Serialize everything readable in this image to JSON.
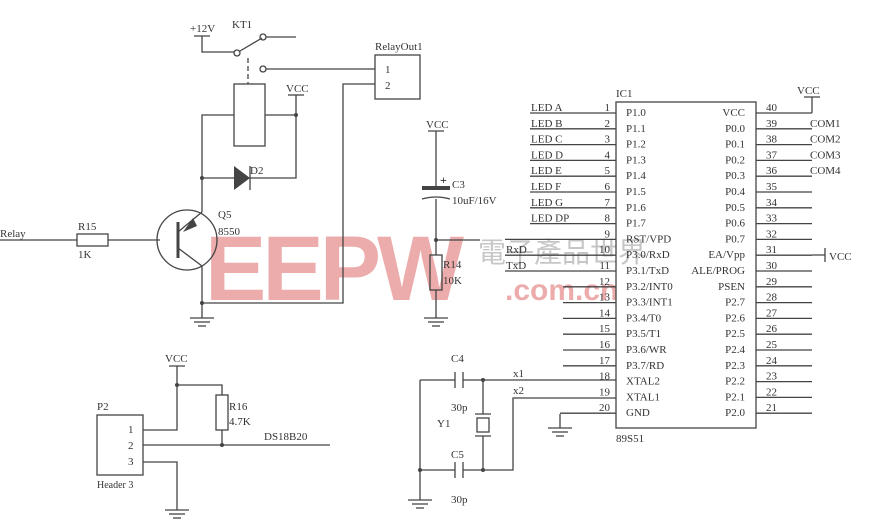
{
  "relay_circuit": {
    "input_net": "Relay",
    "r15": {
      "ref": "R15",
      "value": "1K"
    },
    "q5": {
      "ref": "Q5",
      "value": "8550"
    },
    "d2": {
      "ref": "D2"
    },
    "kt1": {
      "ref": "KT1",
      "supply": "+12V"
    },
    "coil_supply": "VCC",
    "relay_out": {
      "ref": "RelayOut1",
      "pins": [
        "1",
        "2"
      ]
    }
  },
  "reset_circuit": {
    "supply": "VCC",
    "c3": {
      "ref": "C3",
      "value": "10uF/16V"
    },
    "r14": {
      "ref": "R14",
      "value": "10K"
    }
  },
  "crystal": {
    "c4": {
      "ref": "C4",
      "value": "30p"
    },
    "c5": {
      "ref": "C5",
      "value": "30p"
    },
    "y1": {
      "ref": "Y1"
    },
    "net_x1": "x1",
    "net_x2": "x2"
  },
  "sensor": {
    "supply": "VCC",
    "p2": {
      "ref": "P2",
      "part": "Header 3",
      "pins": [
        "1",
        "2",
        "3"
      ]
    },
    "r16": {
      "ref": "R16",
      "value": "4.7K"
    },
    "net": "DS18B20"
  },
  "ic1": {
    "ref": "IC1",
    "part": "89S51",
    "vcc_label": "VCC",
    "ea_vcc_label": "VCC",
    "left_pins": [
      {
        "num": "1",
        "name": "P1.0",
        "net": "LED A"
      },
      {
        "num": "2",
        "name": "P1.1",
        "net": "LED B"
      },
      {
        "num": "3",
        "name": "P1.2",
        "net": "LED C"
      },
      {
        "num": "4",
        "name": "P1.3",
        "net": "LED D"
      },
      {
        "num": "5",
        "name": "P1.4",
        "net": "LED E"
      },
      {
        "num": "6",
        "name": "P1.5",
        "net": "LED F"
      },
      {
        "num": "7",
        "name": "P1.6",
        "net": "LED G"
      },
      {
        "num": "8",
        "name": "P1.7",
        "net": "LED DP"
      },
      {
        "num": "9",
        "name": "RST/VPD",
        "net": ""
      },
      {
        "num": "10",
        "name": "P3.0/RxD",
        "net": "RxD"
      },
      {
        "num": "11",
        "name": "P3.1/TxD",
        "net": "TxD"
      },
      {
        "num": "12",
        "name": "P3.2/INT0",
        "net": ""
      },
      {
        "num": "13",
        "name": "P3.3/INT1",
        "net": ""
      },
      {
        "num": "14",
        "name": "P3.4/T0",
        "net": ""
      },
      {
        "num": "15",
        "name": "P3.5/T1",
        "net": ""
      },
      {
        "num": "16",
        "name": "P3.6/WR",
        "net": ""
      },
      {
        "num": "17",
        "name": "P3.7/RD",
        "net": ""
      },
      {
        "num": "18",
        "name": "XTAL2",
        "net": ""
      },
      {
        "num": "19",
        "name": "XTAL1",
        "net": ""
      },
      {
        "num": "20",
        "name": "GND",
        "net": ""
      }
    ],
    "right_pins": [
      {
        "num": "40",
        "name": "VCC",
        "net": ""
      },
      {
        "num": "39",
        "name": "P0.0",
        "net": "COM1"
      },
      {
        "num": "38",
        "name": "P0.1",
        "net": "COM2"
      },
      {
        "num": "37",
        "name": "P0.2",
        "net": "COM3"
      },
      {
        "num": "36",
        "name": "P0.3",
        "net": "COM4"
      },
      {
        "num": "35",
        "name": "P0.4",
        "net": ""
      },
      {
        "num": "34",
        "name": "P0.5",
        "net": ""
      },
      {
        "num": "33",
        "name": "P0.6",
        "net": ""
      },
      {
        "num": "32",
        "name": "P0.7",
        "net": ""
      },
      {
        "num": "31",
        "name": "EA/Vpp",
        "net": ""
      },
      {
        "num": "30",
        "name": "ALE/PROG",
        "net": ""
      },
      {
        "num": "29",
        "name": "PSEN",
        "net": ""
      },
      {
        "num": "28",
        "name": "P2.7",
        "net": ""
      },
      {
        "num": "27",
        "name": "P2.6",
        "net": ""
      },
      {
        "num": "26",
        "name": "P2.5",
        "net": ""
      },
      {
        "num": "25",
        "name": "P2.4",
        "net": ""
      },
      {
        "num": "24",
        "name": "P2.3",
        "net": ""
      },
      {
        "num": "23",
        "name": "P2.2",
        "net": ""
      },
      {
        "num": "22",
        "name": "P2.1",
        "net": ""
      },
      {
        "num": "21",
        "name": "P2.0",
        "net": ""
      }
    ]
  },
  "watermark": {
    "logo": "EEPW",
    "chinese": "電子產品世界",
    "domain": ".com.cn",
    "color": "#e06a6a"
  }
}
